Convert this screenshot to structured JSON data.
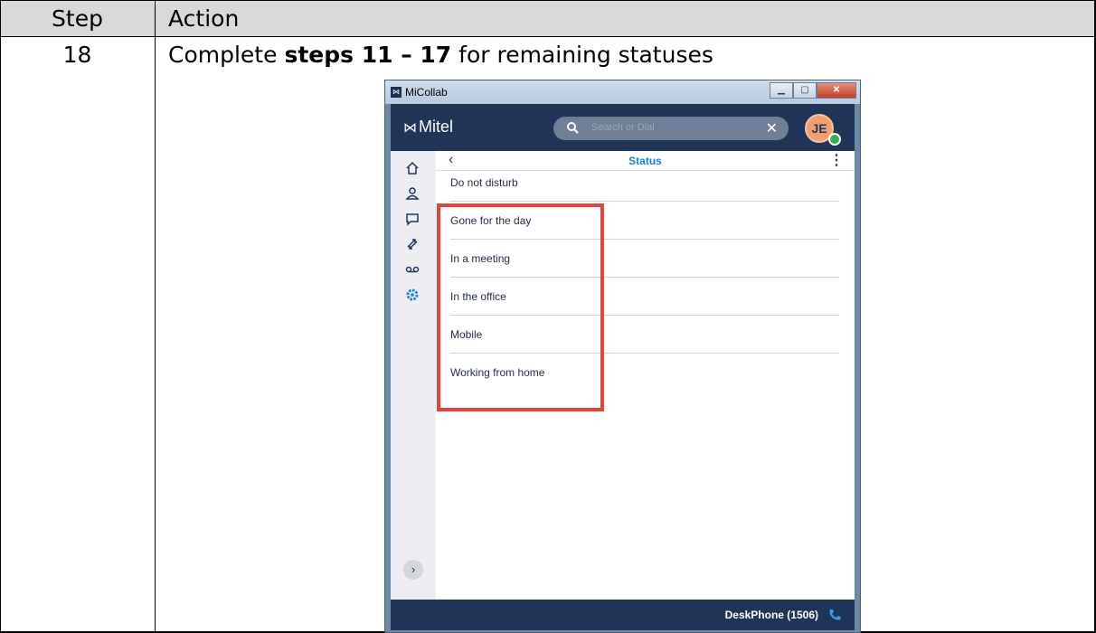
{
  "table": {
    "header_step": "Step",
    "header_action": "Action",
    "step_number": "18",
    "instruction_prefix": "Complete ",
    "instruction_bold": "steps 11 – 17",
    "instruction_suffix": " for remaining statuses"
  },
  "app": {
    "window_title": "MiCollab",
    "brand": "Mitel",
    "search_placeholder": "Search or Dial",
    "avatar_initials": "JE",
    "page_title": "Status",
    "statuses": [
      {
        "label": "Do not disturb"
      },
      {
        "label": "Gone for the day"
      },
      {
        "label": "In a meeting"
      },
      {
        "label": "In the office"
      },
      {
        "label": "Mobile"
      },
      {
        "label": "Working from home"
      }
    ],
    "device": "DeskPhone (1506)",
    "sidebar_icons": [
      "home-icon",
      "contacts-icon",
      "chat-icon",
      "calls-icon",
      "voicemail-icon",
      "settings-icon"
    ]
  },
  "colors": {
    "nav_bar": "#1f3558",
    "accent": "#1d82c4",
    "highlight": "#e2433a",
    "presence": "#34b34a"
  }
}
